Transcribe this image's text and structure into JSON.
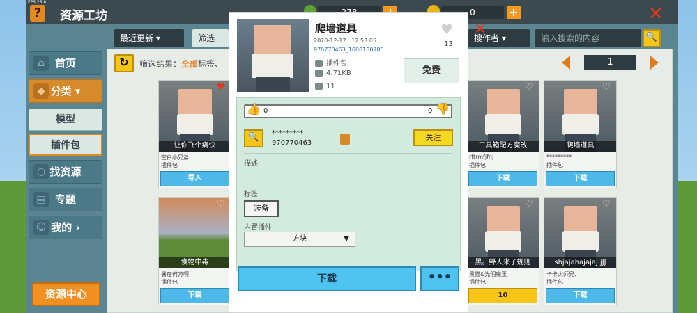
{
  "fps": "FPS 26.8",
  "app_title": "资源工坊",
  "currency": {
    "beans": "278",
    "coins": "0"
  },
  "sidebar": {
    "home": "首页",
    "category": "分类",
    "model": "模型",
    "plugin": "插件包",
    "find": "找资源",
    "topic": "专题",
    "mine": "我的",
    "resource_center": "资源中心"
  },
  "filters": {
    "sort": "最近更新",
    "filter": "筛选",
    "author": "搜作者",
    "search_placeholder": "输入搜索的内容",
    "result_prefix": "筛选结果：",
    "result_all": "全部",
    "result_tag": "标签、",
    "page": "1"
  },
  "cards": [
    {
      "title": "让你飞个痛快",
      "author": "空白小兄弟",
      "type": "插件包",
      "button": "导入",
      "liked": true
    },
    {
      "title": "工具箱配方魔改",
      "author": "rftrmfjfnj",
      "type": "插件包",
      "button": "下载",
      "liked": false
    },
    {
      "title": "爬墙道具",
      "author": "*********",
      "type": "插件包",
      "button": "下载",
      "liked": false
    },
    {
      "title": "食物中毒",
      "author": "暑在何方啊",
      "type": "插件包",
      "button": "下载",
      "liked": false
    },
    {
      "title": "黑。野人来了规则",
      "author": "黑猫&光明魔王",
      "type": "插件包",
      "button": "10",
      "liked": false
    },
    {
      "title": "shjajahajajaj jJJ",
      "author": "卡卡大师兄、",
      "type": "插件包",
      "button": "下载",
      "liked": false
    }
  ],
  "detail": {
    "title": "爬墙道具",
    "date": "2020-12-17",
    "time": "12:53:05",
    "id": "970770463_1608180785",
    "type": "插件包",
    "size": "4.71KB",
    "downloads": "11",
    "likes": "13",
    "free": "免费",
    "thumbs_up": "0",
    "thumbs_down": "0",
    "author_name": "*********",
    "author_id": "970770463",
    "follow": "关注",
    "desc_label": "描述",
    "tag_label": "标签",
    "tag": "装备",
    "builtin_label": "内置插件",
    "builtin_value": "方块",
    "download": "下载",
    "more": "•••"
  },
  "colors": {
    "accent": "#f5c518",
    "download": "#4ec3ef",
    "orange": "#f08f22",
    "close": "#e2381e"
  }
}
